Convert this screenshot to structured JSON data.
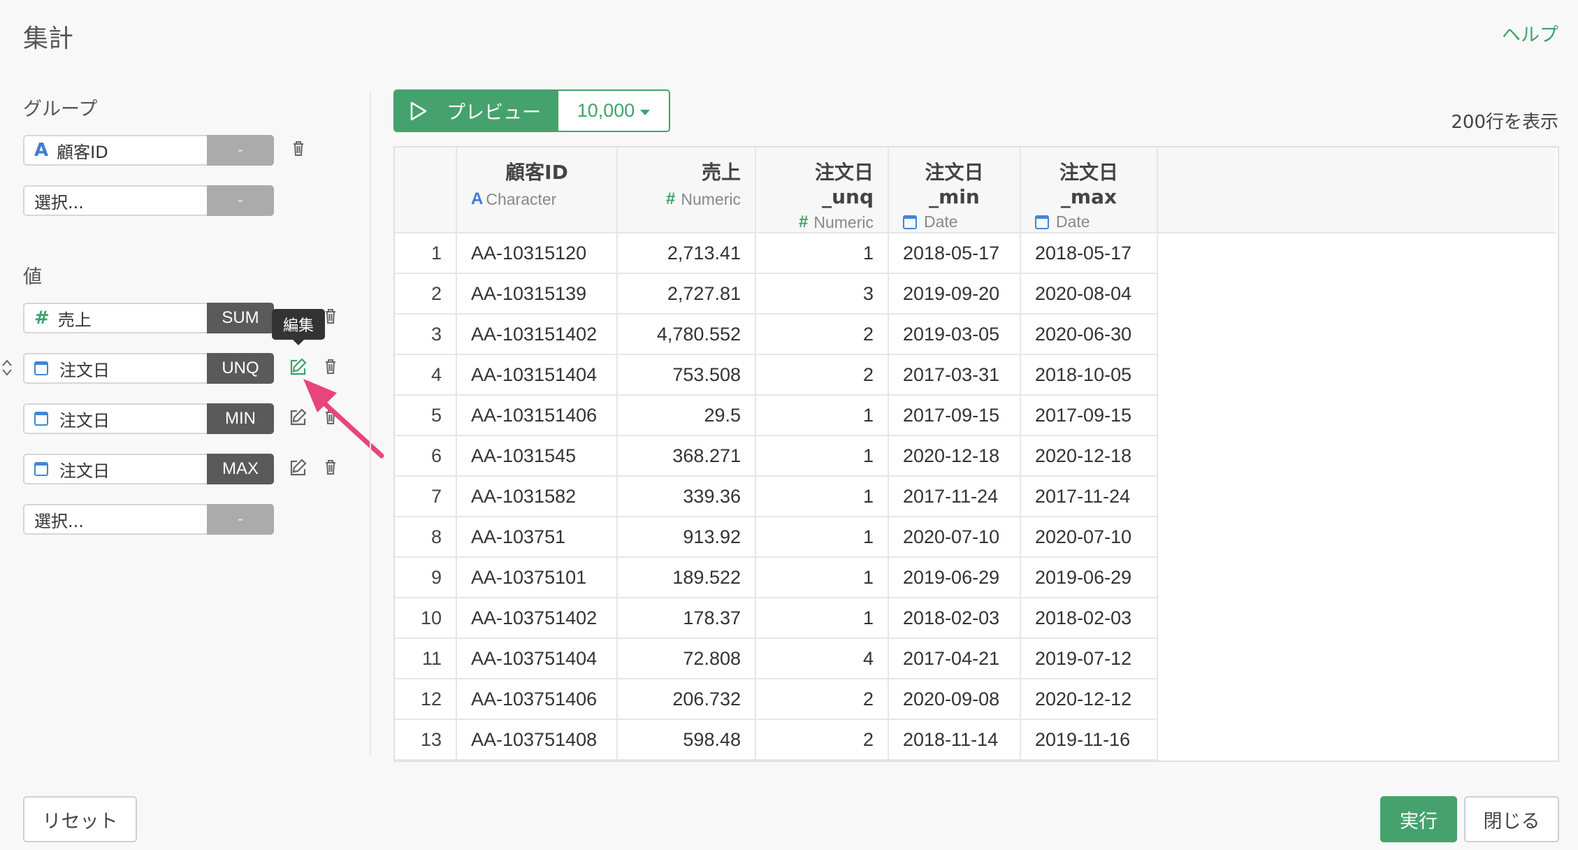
{
  "dialog": {
    "title": "集計",
    "help_label": "ヘルプ"
  },
  "group_section": {
    "label": "グループ",
    "fields": [
      {
        "type_icon": "character-icon",
        "type_glyph": "A",
        "name": "顧客ID",
        "agg": "-"
      },
      {
        "name": "選択...",
        "agg": "-"
      }
    ]
  },
  "value_section": {
    "label": "値",
    "fields": [
      {
        "type_icon": "numeric-icon",
        "type_glyph": "#",
        "name": "売上",
        "agg": "SUM"
      },
      {
        "type_icon": "calendar-icon",
        "name": "注文日",
        "agg": "UNQ"
      },
      {
        "type_icon": "calendar-icon",
        "name": "注文日",
        "agg": "MIN"
      },
      {
        "type_icon": "calendar-icon",
        "name": "注文日",
        "agg": "MAX"
      },
      {
        "name": "選択...",
        "agg": "-"
      }
    ],
    "tooltip": "編集"
  },
  "preview": {
    "button_label": "プレビュー",
    "count_label": "10,000",
    "row_count_text": "200行を表示"
  },
  "table": {
    "columns": [
      {
        "name": "顧客ID",
        "type": "Character",
        "type_glyph": "A"
      },
      {
        "name": "売上",
        "type": "Numeric",
        "type_glyph": "#"
      },
      {
        "name": "注文日_unq",
        "type": "Numeric",
        "type_glyph": "#"
      },
      {
        "name": "注文日_min",
        "type": "Date"
      },
      {
        "name": "注文日_max",
        "type": "Date"
      }
    ],
    "rows": [
      [
        "1",
        "AA-10315120",
        "2,713.41",
        "1",
        "2018-05-17",
        "2018-05-17"
      ],
      [
        "2",
        "AA-10315139",
        "2,727.81",
        "3",
        "2019-09-20",
        "2020-08-04"
      ],
      [
        "3",
        "AA-103151402",
        "4,780.552",
        "2",
        "2019-03-05",
        "2020-06-30"
      ],
      [
        "4",
        "AA-103151404",
        "753.508",
        "2",
        "2017-03-31",
        "2018-10-05"
      ],
      [
        "5",
        "AA-103151406",
        "29.5",
        "1",
        "2017-09-15",
        "2017-09-15"
      ],
      [
        "6",
        "AA-1031545",
        "368.271",
        "1",
        "2020-12-18",
        "2020-12-18"
      ],
      [
        "7",
        "AA-1031582",
        "339.36",
        "1",
        "2017-11-24",
        "2017-11-24"
      ],
      [
        "8",
        "AA-103751",
        "913.92",
        "1",
        "2020-07-10",
        "2020-07-10"
      ],
      [
        "9",
        "AA-10375101",
        "189.522",
        "1",
        "2019-06-29",
        "2019-06-29"
      ],
      [
        "10",
        "AA-103751402",
        "178.37",
        "1",
        "2018-02-03",
        "2018-02-03"
      ],
      [
        "11",
        "AA-103751404",
        "72.808",
        "4",
        "2017-04-21",
        "2019-07-12"
      ],
      [
        "12",
        "AA-103751406",
        "206.732",
        "2",
        "2020-09-08",
        "2020-12-12"
      ],
      [
        "13",
        "AA-103751408",
        "598.48",
        "2",
        "2018-11-14",
        "2019-11-16"
      ]
    ]
  },
  "footer": {
    "reset_label": "リセット",
    "run_label": "実行",
    "close_label": "閉じる"
  },
  "colors": {
    "accent_green": "#45a26c",
    "help_green": "#3fa26a",
    "agg_dark": "#5a5a5a",
    "agg_disabled": "#ababab",
    "arrow_pink": "#e8457a",
    "date_blue": "#3f86d8",
    "char_blue": "#3f7bd6"
  }
}
